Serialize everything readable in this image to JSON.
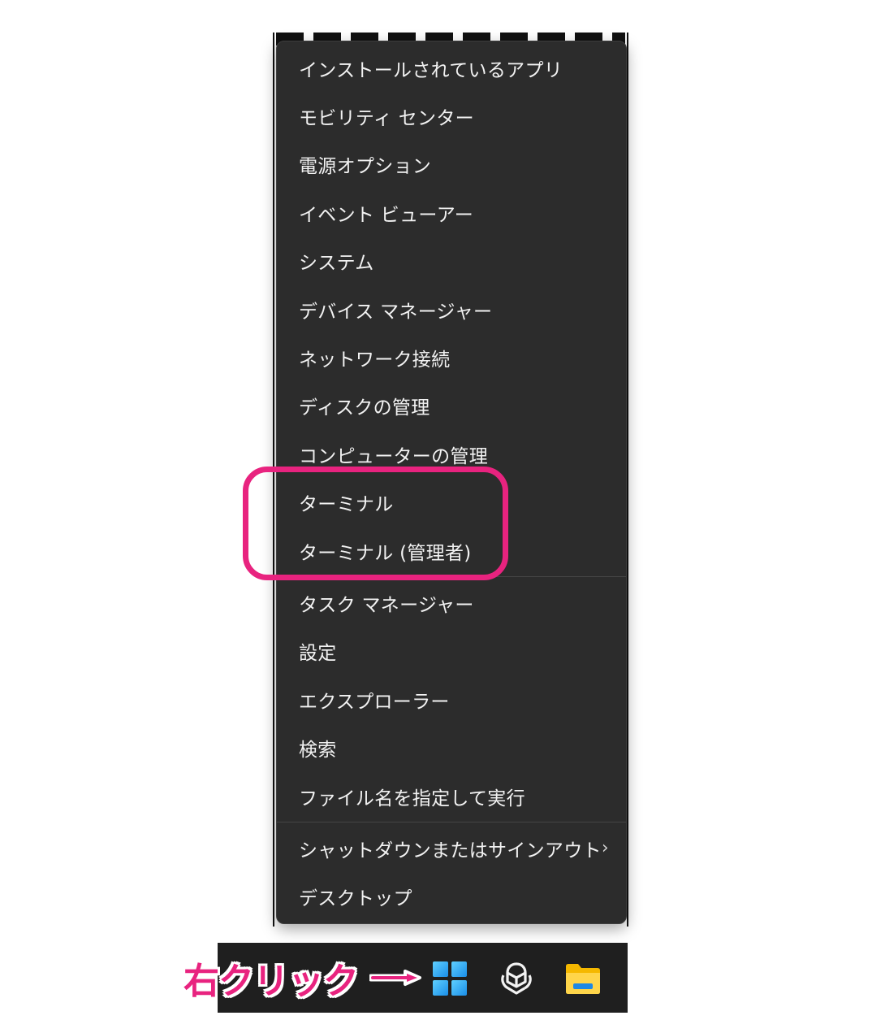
{
  "menu": {
    "items": [
      {
        "label": "インストールされているアプリ"
      },
      {
        "label": "モビリティ センター"
      },
      {
        "label": "電源オプション"
      },
      {
        "label": "イベント ビューアー"
      },
      {
        "label": "システム"
      },
      {
        "label": "デバイス マネージャー"
      },
      {
        "label": "ネットワーク接続"
      },
      {
        "label": "ディスクの管理"
      },
      {
        "label": "コンピューターの管理"
      },
      {
        "label": "ターミナル"
      },
      {
        "label": "ターミナル (管理者)"
      },
      {
        "label": "タスク マネージャー"
      },
      {
        "label": "設定"
      },
      {
        "label": "エクスプローラー"
      },
      {
        "label": "検索"
      },
      {
        "label": "ファイル名を指定して実行"
      },
      {
        "label": "シャットダウンまたはサインアウト",
        "submenu_icon": "chevron-right-icon"
      },
      {
        "label": "デスクトップ"
      }
    ]
  },
  "annotation": {
    "caption": "右クリック",
    "arrow_icon": "arrow-right-icon",
    "accent_color": "#e8237f"
  },
  "taskbar": {
    "icons": [
      "windows-start-icon",
      "chatgpt-icon",
      "file-explorer-folder-icon"
    ],
    "background": "#1f1f1f"
  },
  "colors": {
    "menu_background": "#2c2c2c",
    "menu_text": "#f2f2f2",
    "separator": "#454545"
  }
}
